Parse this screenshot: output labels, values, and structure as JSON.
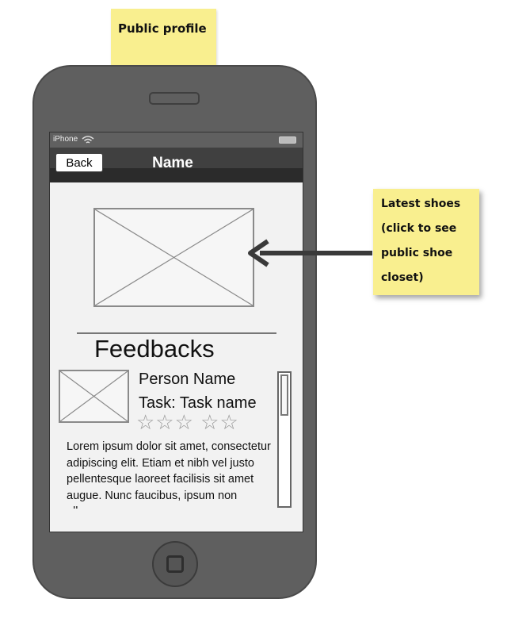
{
  "annotations": {
    "top_note": "Public profile",
    "side_note": [
      "Latest shoes",
      "(click to see",
      "public shoe",
      "closet)"
    ]
  },
  "status_bar": {
    "carrier": "iPhone"
  },
  "nav": {
    "back_label": "Back",
    "title": "Name"
  },
  "feedbacks": {
    "title": "Feedbacks",
    "person_name": "Person Name",
    "task": "Task: Task name",
    "rating": {
      "value": 0,
      "max": 5,
      "display": "☆☆☆ ☆☆"
    },
    "body": "Lorem ipsum dolor sit amet, consectetur adipiscing elit. Etiam et nibh vel justo pellentesque laoreet facilisis sit amet augue. Nunc faucibus, ipsum non ullamcorper"
  },
  "colors": {
    "sticky": "#f9ef8f",
    "phone_body": "#5f5f5f",
    "nav_bar": "#404040"
  }
}
